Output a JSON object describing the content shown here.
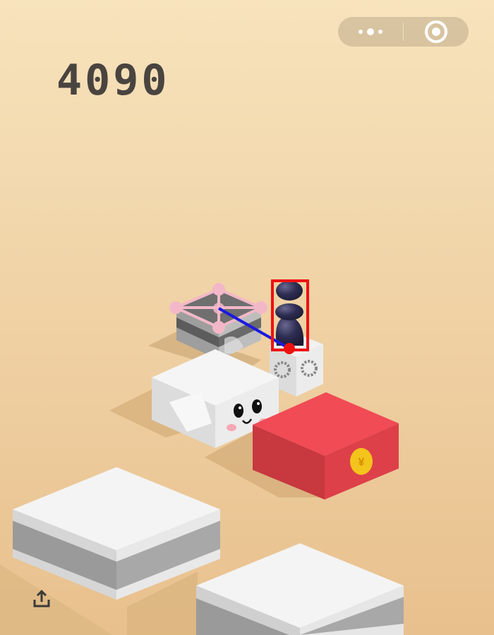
{
  "score": "4090",
  "capsule": {
    "more_icon": "more-dots-icon",
    "close_icon": "target-close-icon"
  },
  "share": {
    "icon": "share-upload-icon"
  },
  "platform_front": {
    "badge_icon": "yen-coin-icon",
    "badge_text": "¥"
  },
  "colors": {
    "bg_top": "#f7e3bc",
    "bg_bottom": "#e9c290",
    "red_box": "#e84a52",
    "overlay_pink": "#f3b8c8",
    "overlay_line": "#1a1adf",
    "overlay_box": "#ee1111"
  }
}
